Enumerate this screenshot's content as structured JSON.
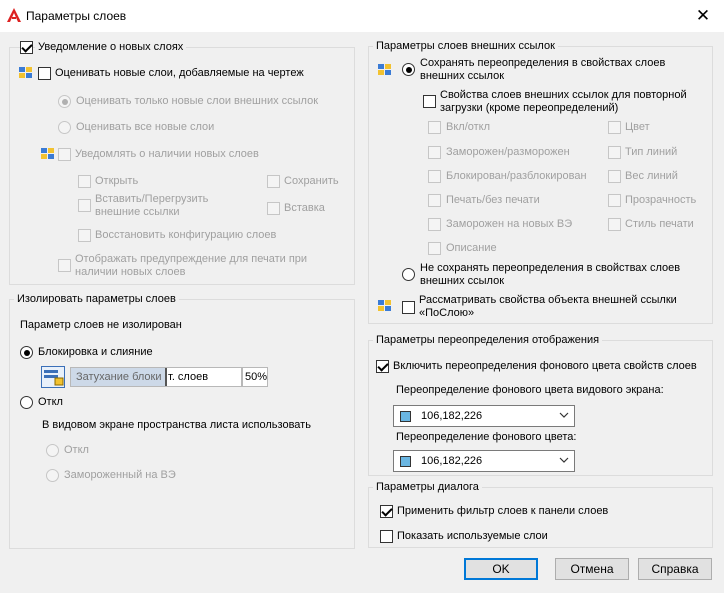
{
  "title": "Параметры слоев",
  "icons": {
    "app": "autocad-logo",
    "close": "close-icon",
    "layers": "layer-stack-icon",
    "fade": "layer-fade-icon"
  },
  "colors": {
    "swatch": "#6ab6e2",
    "default_border": "#0078d7"
  },
  "notification": {
    "legend": "Уведомление о новых слоях",
    "evaluate_new": "Оценивать новые слои, добавляемые на чертеж",
    "only_xref": "Оценивать только новые слои внешних ссылок",
    "all_new": "Оценивать все новые слои",
    "notify_present": "Уведомлять о наличии новых слоев",
    "open": "Открыть",
    "save": "Сохранить",
    "insert_reload": "Вставить/Перегрузить внешние ссылки",
    "insert": "Вставка",
    "restore": "Восстановить конфигурацию слоев",
    "print_warning": "Отображать предупреждение для печати при наличии новых слоев"
  },
  "isolate": {
    "legend": "Изолировать параметры слоев",
    "status": "Параметр слоев не изолирован",
    "lock_fade": "Блокировка и слияние",
    "fade_label": "Затухание блоки",
    "fade_label_suffix": "т. слоев",
    "fade_value": "50%",
    "off": "Откл",
    "viewport_use": "В видовом экране пространства листа использовать",
    "vp_off": "Откл",
    "vp_frozen": "Замороженный на ВЭ"
  },
  "xref": {
    "legend": "Параметры слоев внешних ссылок",
    "keep_overrides": "Сохранять переопределения в свойствах слоев внешних ссылок",
    "reload_props": "Свойства слоев внешних ссылок для повторной загрузки (кроме переопределений)",
    "on_off": "Вкл/откл",
    "color": "Цвет",
    "freeze": "Заморожен/разморожен",
    "linetype": "Тип линий",
    "lock": "Блокирован/разблокирован",
    "lineweight": "Вес линий",
    "plot": "Печать/без печати",
    "transparency": "Прозрачность",
    "frozen_vp": "Заморожен на новых ВЭ",
    "plot_style": "Стиль печати",
    "description": "Описание",
    "no_keep": "Не сохранять переопределения в свойствах слоев внешних ссылок",
    "treat_bylayer": "Рассматривать свойства объекта внешней ссылки «ПоСлою»"
  },
  "display": {
    "legend": "Параметры переопределения отображения",
    "enable_bg": "Включить переопределения фонового цвета свойств слоев",
    "vp_bg_label": "Переопределение фонового цвета видового экрана:",
    "vp_bg_value": "106,182,226",
    "bg_label": "Переопределение фонового цвета:",
    "bg_value": "106,182,226"
  },
  "dialog": {
    "legend": "Параметры диалога",
    "apply_filter": "Применить фильтр слоев к панели слоев",
    "show_used": "Показать используемые слои"
  },
  "buttons": {
    "ok": "OK",
    "cancel": "Отмена",
    "help": "Справка"
  }
}
